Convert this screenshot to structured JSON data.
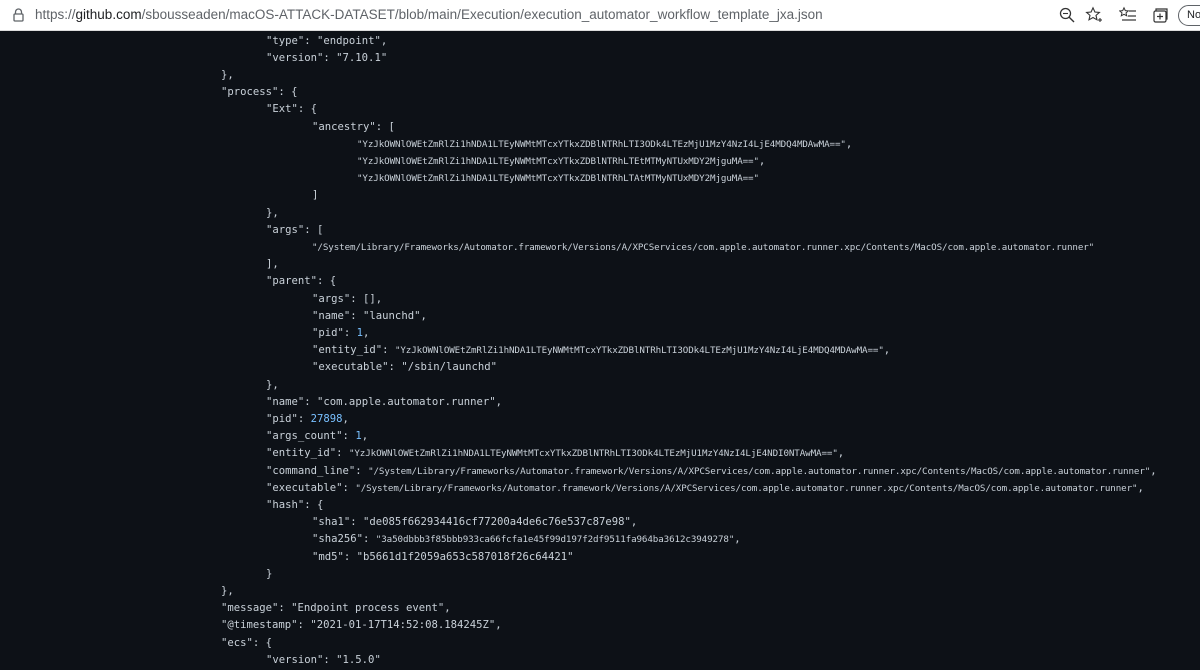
{
  "browser": {
    "url_scheme": "https://",
    "url_host": "github.com",
    "url_path": "/sbousseaden/macOS-ATTACK-DATASET/blob/main/Execution/execution_automator_workflow_template_jxa.json",
    "profile_label": "No",
    "icons": [
      "lock-icon",
      "zoom-icon",
      "favorite-star-icon",
      "favorites-list-icon",
      "collections-icon"
    ]
  },
  "code": {
    "type_value": "\"endpoint\"",
    "version_value": "\"7.10.1\"",
    "ancestry": [
      "\"YzJkOWNlOWEtZmRlZi1hNDA1LTEyNWMtMTcxYTkxZDBlNTRhLTI3ODk4LTEzMjU1MzY4NzI4LjE4MDQ4MDAwMA==\"",
      "\"YzJkOWNlOWEtZmRlZi1hNDA1LTEyNWMtMTcxYTkxZDBlNTRhLTEtMTMyNTUxMDY2MjguMA==\"",
      "\"YzJkOWNlOWEtZmRlZi1hNDA1LTEyNWMtMTcxYTkxZDBlNTRhLTAtMTMyNTUxMDY2MjguMA==\""
    ],
    "args_value": "\"/System/Library/Frameworks/Automator.framework/Versions/A/XPCServices/com.apple.automator.runner.xpc/Contents/MacOS/com.apple.automator.runner\"",
    "parent_name": "\"launchd\"",
    "parent_pid": "1",
    "parent_entity_id": "\"YzJkOWNlOWEtZmRlZi1hNDA1LTEyNWMtMTcxYTkxZDBlNTRhLTI3ODk4LTEzMjU1MzY4NzI4LjE4MDQ4MDAwMA==\"",
    "parent_executable": "\"/sbin/launchd\"",
    "name_value": "\"com.apple.automator.runner\"",
    "pid_value": "27898",
    "args_count_value": "1",
    "entity_id_value": "\"YzJkOWNlOWEtZmRlZi1hNDA1LTEyNWMtMTcxYTkxZDBlNTRhLTI3ODk4LTEzMjU1MzY4NzI4LjE4NDI0NTAwMA==\"",
    "command_line_value": "\"/System/Library/Frameworks/Automator.framework/Versions/A/XPCServices/com.apple.automator.runner.xpc/Contents/MacOS/com.apple.automator.runner\"",
    "executable_value": "\"/System/Library/Frameworks/Automator.framework/Versions/A/XPCServices/com.apple.automator.runner.xpc/Contents/MacOS/com.apple.automator.runner\"",
    "sha1_value": "\"de085f662934416cf77200a4de6c76e537c87e98\"",
    "sha256_value": "\"3a50dbbb3f85bbb933ca66fcfa1e45f99d197f2df9511fa964ba3612c3949278\"",
    "md5_value": "\"b5661d1f2059a653c587018f26c64421\"",
    "message_value": "\"Endpoint process event\"",
    "timestamp_value": "\"2021-01-17T14:52:08.184245Z\"",
    "ecs_version_value": "\"1.5.0\""
  }
}
